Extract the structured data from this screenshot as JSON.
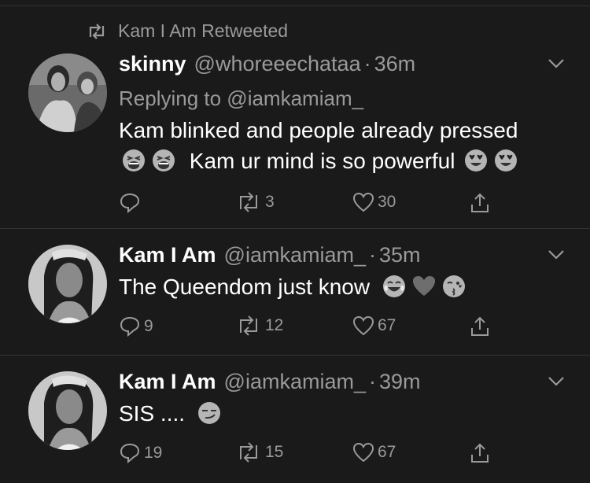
{
  "retweet_banner": {
    "label": "Kam I Am Retweeted",
    "icon": "retweet-icon"
  },
  "tweets": [
    {
      "name": "skinny",
      "handle": "@whoreeechataa",
      "sep": "·",
      "time": "36m",
      "replying_to": "Replying to @iamkamiam_",
      "line1": "Kam blinked and people already pressed",
      "line2_text": "Kam ur mind is so powerful",
      "emojis_line2_before": [
        "tired-face-emoji",
        "tired-face-emoji"
      ],
      "emojis_line2_after": [
        "heart-eyes-emoji",
        "heart-eyes-emoji"
      ],
      "reply_count": "",
      "retweet_count": "3",
      "like_count": "30"
    },
    {
      "name": "Kam I Am",
      "handle": "@iamkamiam_",
      "sep": "·",
      "time": "35m",
      "text": "The Queendom just know",
      "emojis": [
        "tears-of-joy-emoji",
        "heart-emoji",
        "kissing-wink-emoji"
      ],
      "reply_count": "9",
      "retweet_count": "12",
      "like_count": "67"
    },
    {
      "name": "Kam I Am",
      "handle": "@iamkamiam_",
      "sep": "·",
      "time": "39m",
      "text": "SIS ....",
      "emojis": [
        "smirk-emoji"
      ],
      "reply_count": "19",
      "retweet_count": "15",
      "like_count": "67"
    }
  ],
  "colors": {
    "background": "#1a1a1a",
    "text": "#ffffff",
    "muted": "#9a9a9a",
    "divider": "#333333"
  }
}
